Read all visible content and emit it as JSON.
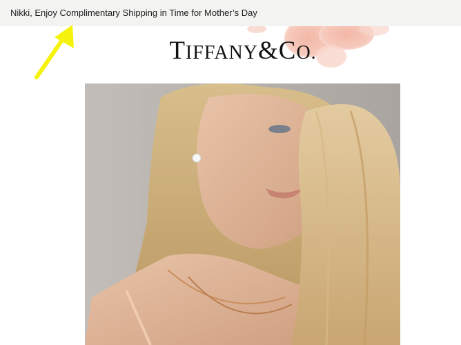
{
  "email": {
    "subject": "Nikki, Enjoy Complimentary Shipping in Time for Mother’s Day"
  },
  "brand": {
    "logo_text": "TIFFANY&CO.",
    "logo_parts": {
      "t1": "T",
      "r1": "IFFANY",
      "amp": "&",
      "c": "C",
      "o": "O."
    }
  },
  "annotation": {
    "arrow_color": "#f5f20b"
  },
  "icons": {
    "arrow": "arrow-annotation-icon",
    "flower": "flower-decoration-icon"
  }
}
